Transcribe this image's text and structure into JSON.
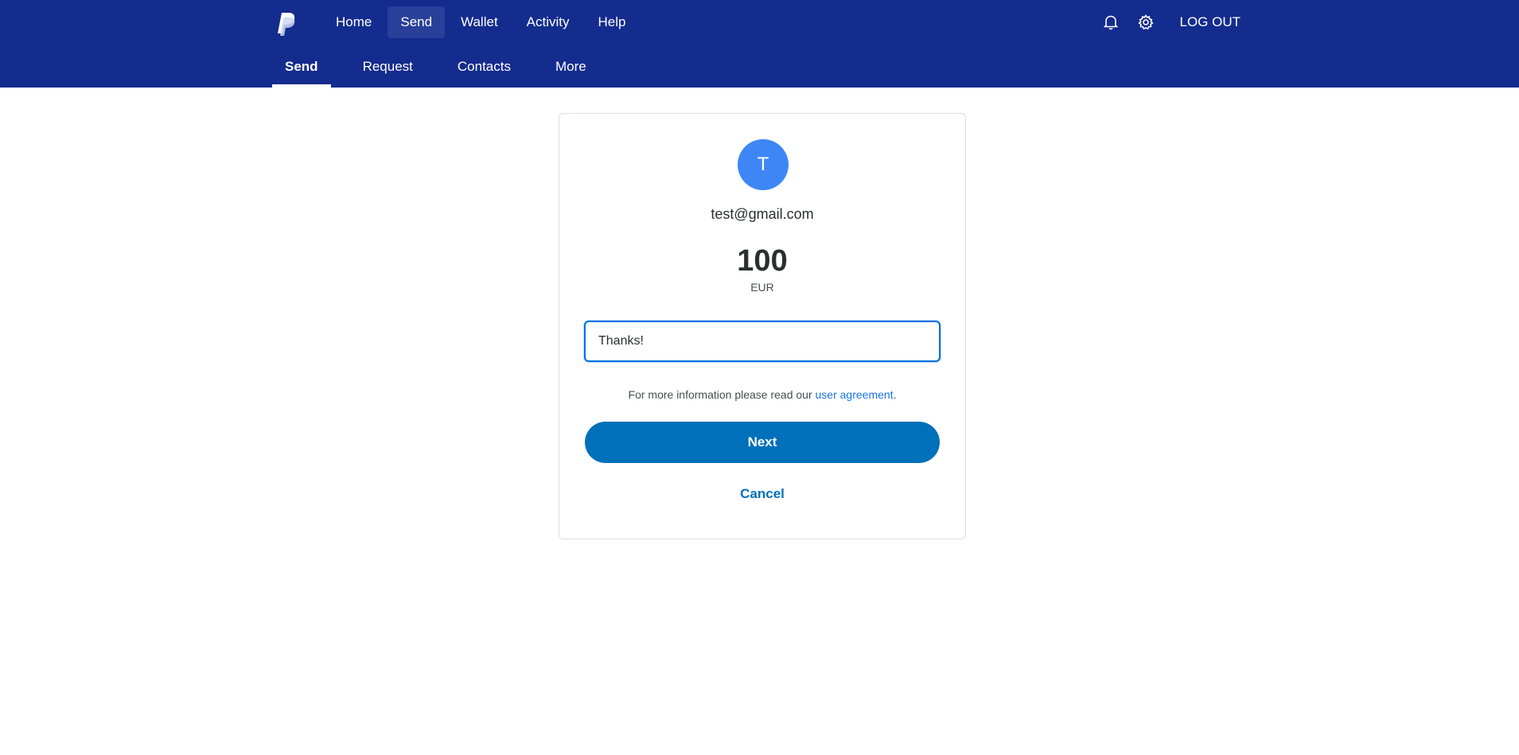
{
  "header": {
    "logo_icon": "paypal-logo",
    "nav": [
      {
        "label": "Home",
        "active": false
      },
      {
        "label": "Send",
        "active": true
      },
      {
        "label": "Wallet",
        "active": false
      },
      {
        "label": "Activity",
        "active": false
      },
      {
        "label": "Help",
        "active": false
      }
    ],
    "icons": [
      "bell-icon",
      "gear-icon"
    ],
    "logout_label": "LOG OUT",
    "background_color": "#142c8e"
  },
  "subnav": [
    {
      "label": "Send",
      "active": true
    },
    {
      "label": "Request",
      "active": false
    },
    {
      "label": "Contacts",
      "active": false
    },
    {
      "label": "More",
      "active": false
    }
  ],
  "send_card": {
    "avatar_initial": "T",
    "avatar_color": "#3e86f5",
    "recipient_email": "test@gmail.com",
    "amount": "100",
    "currency": "EUR",
    "note_value": "Thanks!",
    "agreement_text": "For more information please read our ",
    "agreement_link": "user agreement",
    "agreement_suffix": ".",
    "next_label": "Next",
    "next_color": "#0070ba",
    "cancel_label": "Cancel"
  }
}
